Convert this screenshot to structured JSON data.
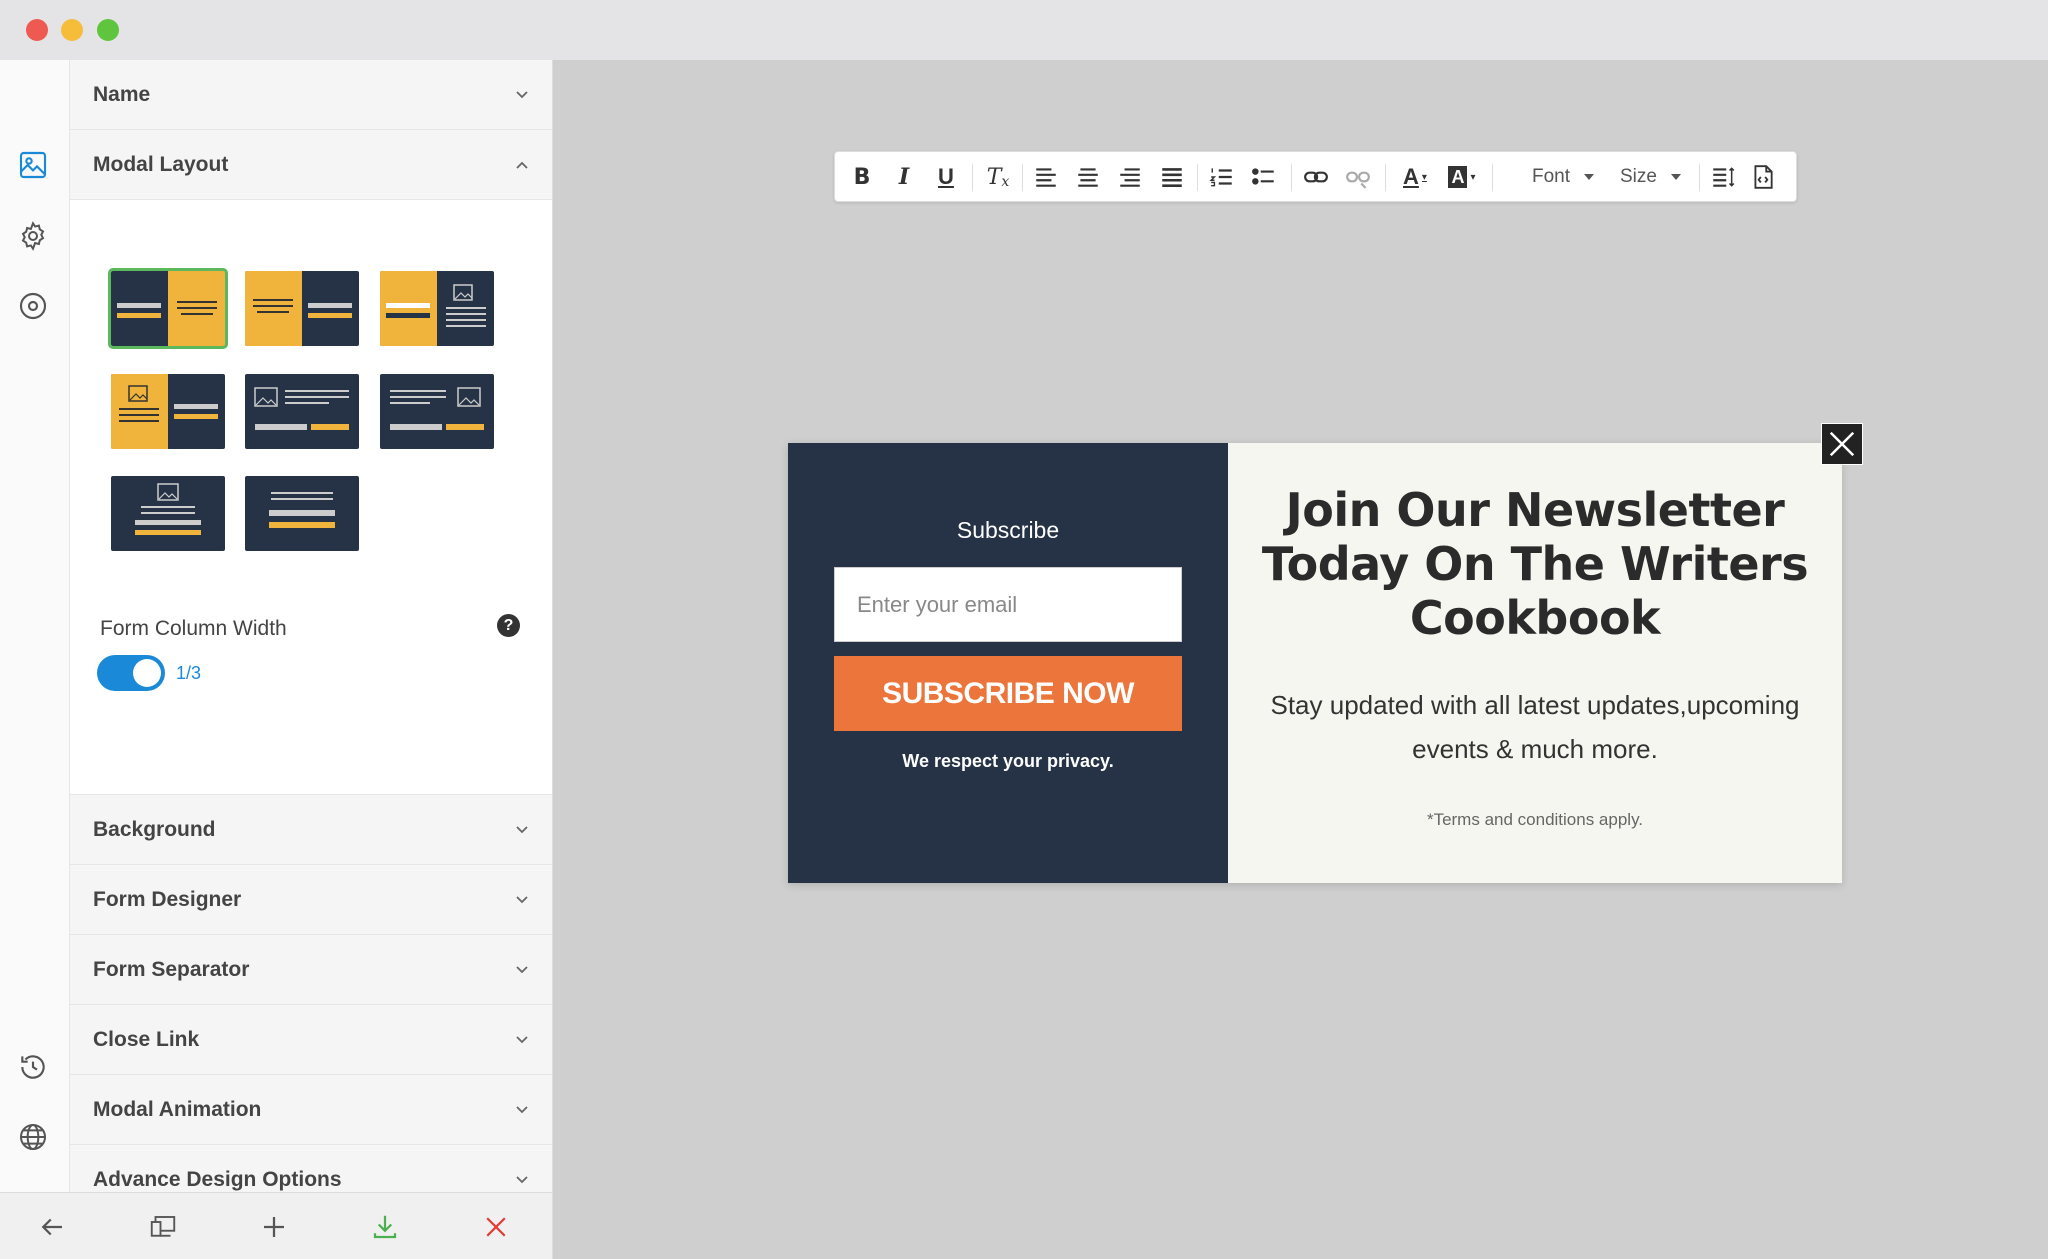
{
  "window": {
    "controls": [
      "close",
      "minimize",
      "maximize"
    ]
  },
  "rail": {
    "icons": [
      "image-icon",
      "gear-icon",
      "target-icon",
      "history-icon",
      "globe-icon"
    ]
  },
  "panel": {
    "sections": {
      "name": "Name",
      "modal_layout": "Modal Layout",
      "background": "Background",
      "form_designer": "Form Designer",
      "form_separator": "Form Separator",
      "close_link": "Close Link",
      "modal_animation": "Modal Animation",
      "advance_design": "Advance Design Options"
    },
    "form_column_width": {
      "label": "Form Column Width",
      "value": "1/3",
      "help": "?"
    }
  },
  "toolbar": {
    "font_label": "Font",
    "size_label": "Size"
  },
  "modal": {
    "subscribe_label": "Subscribe",
    "email_placeholder": "Enter your email",
    "button_label": "SUBSCRIBE NOW",
    "privacy": "We respect your privacy.",
    "headline": "Join Our Newsletter Today On The Writers Cookbook",
    "description": "Stay updated with all latest updates,upcoming events & much more.",
    "terms": "*Terms and conditions apply."
  },
  "colors": {
    "accent_blue": "#1a8ad8",
    "dark_navy": "#263347",
    "amber": "#f0b43c",
    "orange": "#ec753c",
    "selected_green": "#5cb85c"
  }
}
